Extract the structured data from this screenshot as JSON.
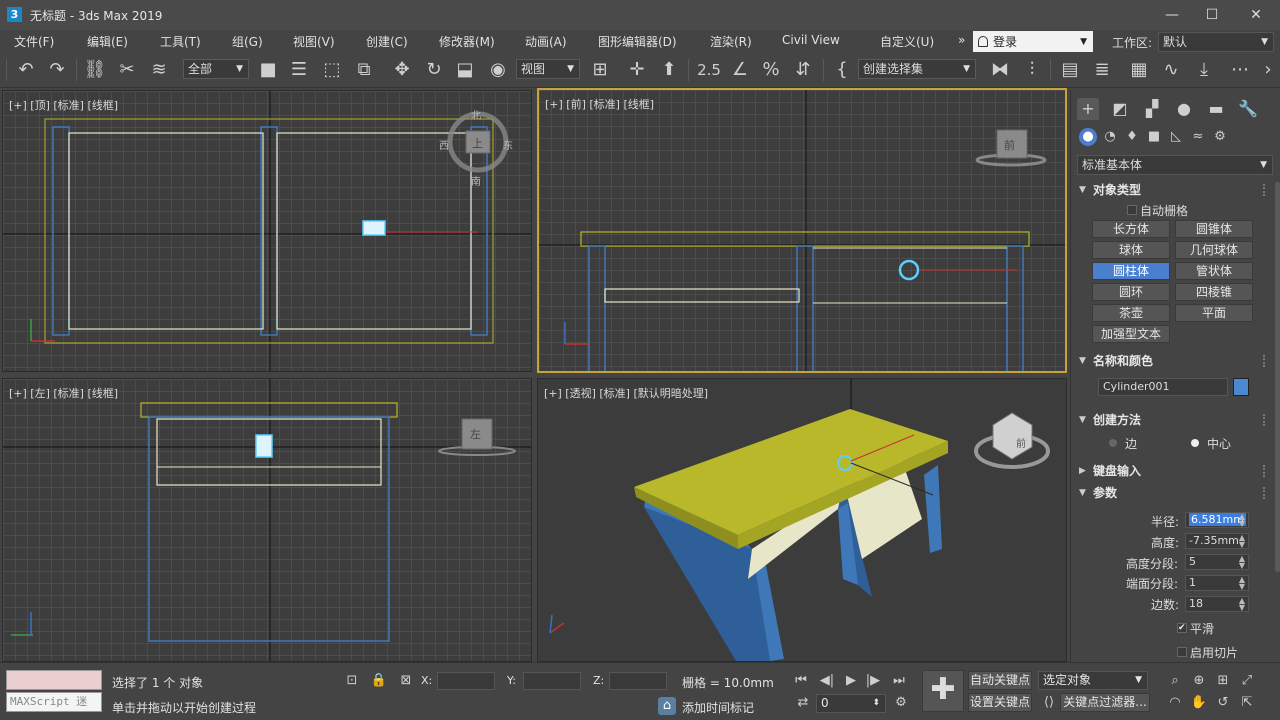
{
  "window": {
    "icon_glyph": "3",
    "title": "无标题 - 3ds Max 2019",
    "minimize_glyph": "—",
    "maximize_glyph": "☐",
    "close_glyph": "✕"
  },
  "menu": {
    "items": [
      "文件(F)",
      "编辑(E)",
      "工具(T)",
      "组(G)",
      "视图(V)",
      "创建(C)",
      "修改器(M)",
      "动画(A)",
      "图形编辑器(D)",
      "渲染(R)",
      "Civil View",
      "自定义(U)"
    ],
    "overflow_glyph": "»",
    "login_label": "登录",
    "workspace_label": "工作区:",
    "workspace_value": "默认"
  },
  "toolbar": {
    "selection_filter": "全部",
    "reference_coord": "视图",
    "named_selection": "创建选择集",
    "snap_label": "2.5",
    "icons": [
      "undo-icon",
      "redo-icon",
      "link-icon",
      "unlink-icon",
      "bind-space-warp-icon",
      "select-icon",
      "select-by-name-icon",
      "rect-region-icon",
      "window-crossing-icon",
      "move-icon",
      "rotate-icon",
      "scale-icon",
      "place-icon",
      "pivot-icon",
      "manipulate-icon",
      "keyboard-shortcut-icon",
      "snap-icon",
      "angle-snap-icon",
      "percent-snap-icon",
      "spinner-snap-icon",
      "edit-named-sel-icon",
      "mirror-icon",
      "align-icon",
      "scene-explorer-icon",
      "layer-explorer-icon",
      "ribbon-icon",
      "curve-editor-icon",
      "schematic-icon",
      "material-editor-icon"
    ]
  },
  "viewports": {
    "top": {
      "label": "[+] [顶] [标准] [线框]",
      "compass": {
        "n": "北",
        "s": "南",
        "e": "东",
        "w": "西",
        "cube_face": "上"
      }
    },
    "front": {
      "label": "[+] [前] [标准] [线框]",
      "cube_face": "前"
    },
    "left": {
      "label": "[+] [左] [标准] [线框]",
      "cube_face": "左"
    },
    "perspective": {
      "label": "[+] [透视] [标准] [默认明暗处理]",
      "cube_face": "前"
    }
  },
  "colors": {
    "selected_wire": "#5ad0ff",
    "table_top": "#b8b82a",
    "table_leg": "#3e78b8",
    "shelf": "#e8e6c8",
    "active_border": "#c9a23c",
    "accent_blue": "#4a7fd0"
  },
  "command_panel": {
    "tab_icons": [
      "create-icon",
      "modify-icon",
      "hierarchy-icon",
      "motion-icon",
      "display-icon",
      "utilities-icon"
    ],
    "sub_icons": [
      "geometry-icon",
      "shapes-icon",
      "lights-icon",
      "cameras-icon",
      "helpers-icon",
      "space-warps-icon",
      "systems-icon"
    ],
    "category": "标准基本体",
    "object_type": {
      "title": "对象类型",
      "autogrid": "自动栅格",
      "buttons": [
        "长方体",
        "圆锥体",
        "球体",
        "几何球体",
        "圆柱体",
        "管状体",
        "圆环",
        "四棱锥",
        "茶壶",
        "平面",
        "加强型文本"
      ],
      "active": "圆柱体"
    },
    "name_color": {
      "title": "名称和颜色",
      "name": "Cylinder001",
      "color": "#4a88d0"
    },
    "creation_method": {
      "title": "创建方法",
      "edge": "边",
      "center": "中心",
      "selected": "中心"
    },
    "keyboard_entry": {
      "title": "键盘输入"
    },
    "parameters": {
      "title": "参数",
      "radius_label": "半径:",
      "radius": "6.581mm",
      "height_label": "高度:",
      "height": "-7.35mm",
      "height_segs_label": "高度分段:",
      "height_segs": "5",
      "cap_segs_label": "端面分段:",
      "cap_segs": "1",
      "sides_label": "边数:",
      "sides": "18",
      "smooth_label": "平滑",
      "slice_label": "启用切片"
    }
  },
  "statusbar": {
    "maxscript_placeholder": "MAXScript 迷",
    "selection_status": "选择了 1 个 对象",
    "prompt": "单击并拖动以开始创建过程",
    "x_label": "X:",
    "y_label": "Y:",
    "z_label": "Z:",
    "grid": "栅格 = 10.0mm",
    "add_time_tag": "添加时间标记",
    "frame": "0",
    "auto_key": "自动关键点",
    "selected_object": "选定对象",
    "set_key": "设置关键点",
    "key_filters": "关键点过滤器...",
    "play_glyphs": [
      "⏮",
      "◀|",
      "▶",
      "|▶",
      "⏭"
    ]
  }
}
